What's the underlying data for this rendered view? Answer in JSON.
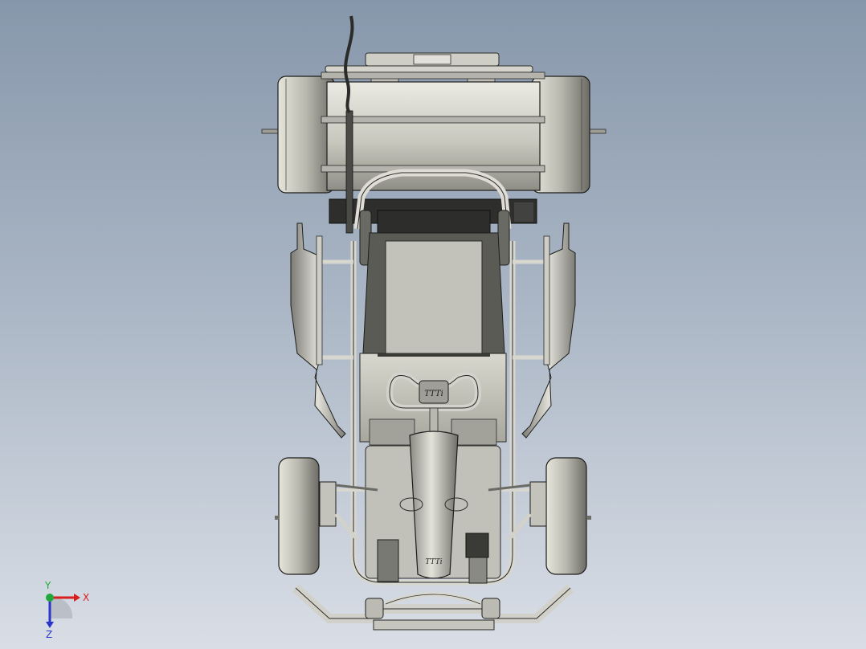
{
  "viewport": {
    "background_top": "#8797ab",
    "background_bottom": "#d9dee6"
  },
  "model": {
    "logo_text": "TTTi",
    "body_color": "#c9c8c0",
    "shadow_color": "#3b3b38",
    "edge_color": "#1d1d1b"
  },
  "triad": {
    "x_label": "X",
    "y_label": "Y",
    "z_label": "Z",
    "x_color": "#d81e1e",
    "y_color": "#22a83a",
    "z_color": "#2a36c9"
  }
}
